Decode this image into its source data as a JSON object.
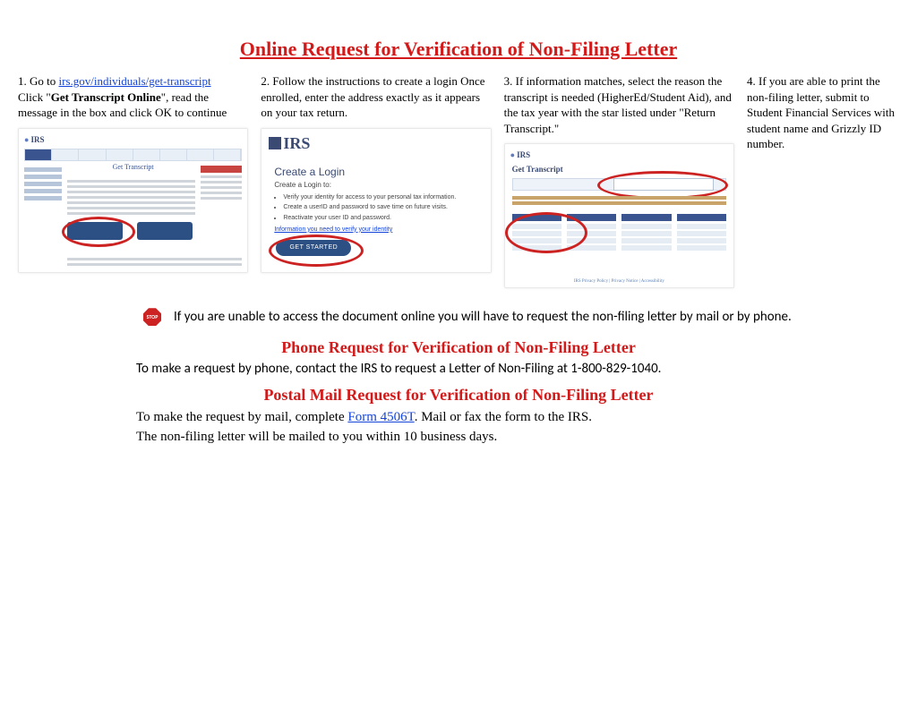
{
  "title": "Online Request for Verification of Non-Filing Letter",
  "steps": {
    "s1": {
      "text1": "1. Go to ",
      "link": "irs.gov/individuals/get-transcript",
      "text2a": "Click \"",
      "bold": "Get Transcript Online",
      "text2b": "\", read the message in the box and click OK to continue"
    },
    "s2": "2. Follow the instructions to create a login Once enrolled, enter the address exactly as it appears on your tax return.",
    "s3": "3. If information matches, select the reason the transcript is needed (HigherEd/Student Aid), and the tax year with the star  listed under \"Return Transcript.\"",
    "s4": "4. If you are able to print the non-filing letter,  submit to Student Financial Services with student name and Grizzly ID number."
  },
  "thumb1": {
    "irs": "IRS",
    "title": "Get Transcript"
  },
  "thumb2": {
    "irs": "IRS",
    "h": "Create a Login",
    "sub": "Create a Login to:",
    "li1": "Verify your identity for access to your personal tax information.",
    "li2": "Create a userID and password to save time on future visits.",
    "li3": "Reactivate your user ID and password.",
    "lnk": "Information you need to verify your identity",
    "go": "GET STARTED"
  },
  "thumb3": {
    "irs": "IRS",
    "hd": "Get Transcript",
    "foot": "IRS Privacy Policy | Privacy Notice | Accessibility"
  },
  "stop": {
    "label": "STOP",
    "msg": "If you are unable to access the document online you will have to request the non-filing letter by mail or by phone."
  },
  "phone": {
    "h": "Phone Request for Verification of Non-Filing Letter",
    "p": "To make a request by phone, contact the IRS to request a Letter of Non-Filing at 1-800-829-1040."
  },
  "mail": {
    "h": "Postal Mail Request for Verification of Non-Filing Letter",
    "p1a": "To make the request by mail, complete ",
    "link": "Form 4506T",
    "p1b": ".  Mail or fax the form to the IRS.",
    "p2": "The non-filing letter will be mailed to you within 10 business days."
  }
}
